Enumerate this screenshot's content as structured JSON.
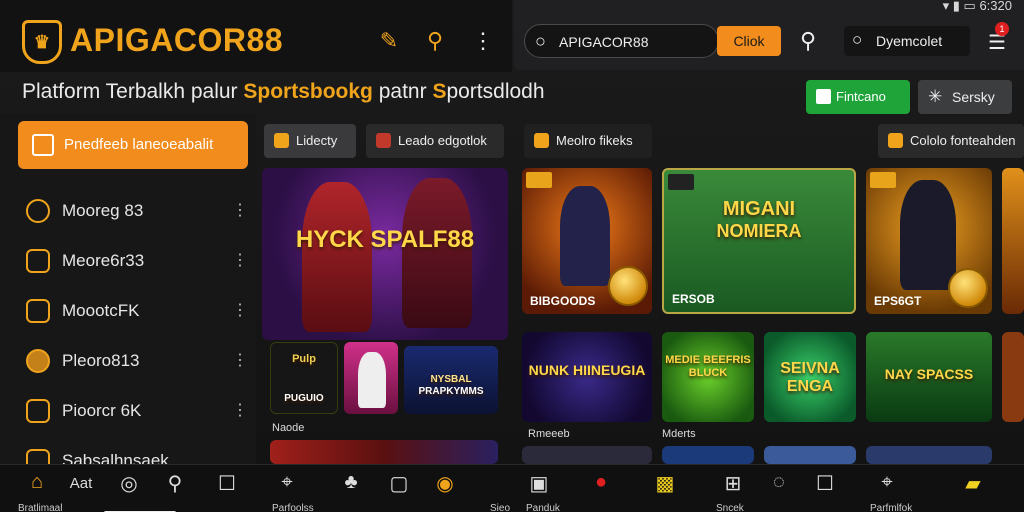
{
  "brand": {
    "name": "APIGACOR88",
    "accent": "#f0a41c"
  },
  "status_bar": {
    "text": "6:320"
  },
  "header_right": {
    "search_text": "APIGACOR88",
    "click_button": "Cliok",
    "secondary_search": "Dyemcolet",
    "notification_count": "1"
  },
  "tagline": {
    "part1": "Platform Terbalkh palur ",
    "part2": "Sportsbookg",
    "part3": " patnr ",
    "part4": "S",
    "part5": "portsdlodh"
  },
  "actions": {
    "green_button": "Fintcano",
    "gray_button": "Sersky"
  },
  "sidebar": {
    "promo": "Pnedfeeb laneoeabalit",
    "items": [
      {
        "label": "Mooreg 83"
      },
      {
        "label": "Meore6r33"
      },
      {
        "label": "MoootcFK"
      },
      {
        "label": "Pleoro813"
      },
      {
        "label": "Pioorcr 6K"
      },
      {
        "label": "Sabsalhnsaek"
      }
    ]
  },
  "tabs": [
    {
      "label": "Lidecty"
    },
    {
      "label": "Leado edgotlok"
    },
    {
      "label": "Meolro fikeks"
    },
    {
      "label": "Cololo fonteahden"
    }
  ],
  "cards": {
    "hero_title": "HYCK SPALF88",
    "hero_tag": "",
    "hero_sub1": "PUGUIO",
    "hero_sub1_top": "Pulp",
    "hero_sub3": "PRAPKYMMS",
    "hero_sub3_top": "NYSBAL",
    "hero_caption": "Naode",
    "g1_foot": "BIBGOODS",
    "g2_title_a": "MIGANI",
    "g2_title_b": "NOMIERA",
    "g2_foot": "ERSOB",
    "g3_foot": "EPS6GT",
    "g4_title": "NUNK HIINEUGIA",
    "g5_title": "MEDIE BEEFRIS BLUCK",
    "g6_title": "SEIVNA ENGA",
    "g7_title": "NAY SPACSS",
    "row2_label_a": "Rmeeeb",
    "row2_label_b": "Mderts"
  },
  "bottom_nav": {
    "home_label": "Bratlimaal",
    "art_label": "Aat",
    "cat_label": "Parfoolss",
    "side_label": "Sieo",
    "panduk_label": "Panduk",
    "search_label": "Sncek",
    "promo_label": "Parfmlfok"
  }
}
